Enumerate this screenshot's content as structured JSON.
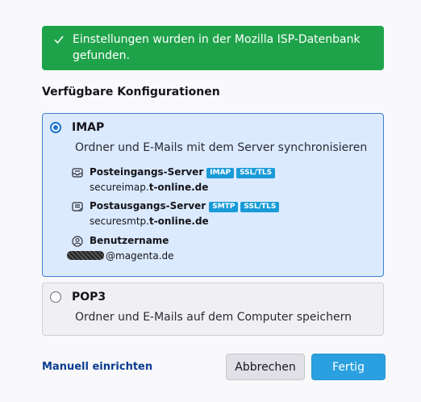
{
  "banner": {
    "text": "Einstellungen wurden in der Mozilla ISP-Datenbank gefunden.",
    "color": "#1fa34a"
  },
  "section_title": "Verfügbare Konfigurationen",
  "options": {
    "imap": {
      "title": "IMAP",
      "description": "Ordner und E-Mails mit dem Server synchronisieren",
      "selected": true,
      "incoming": {
        "label": "Posteingangs-Server",
        "badges": [
          "IMAP",
          "SSL/TLS"
        ],
        "host_prefix": "secureimap.",
        "host_domain": "t-online.de"
      },
      "outgoing": {
        "label": "Postausgangs-Server",
        "badges": [
          "SMTP",
          "SSL/TLS"
        ],
        "host_prefix": "securesmtp.",
        "host_domain": "t-online.de"
      },
      "username": {
        "label": "Benutzername",
        "value_suffix": "@magenta.de"
      }
    },
    "pop3": {
      "title": "POP3",
      "description": "Ordner und E-Mails auf dem Computer speichern",
      "selected": false
    }
  },
  "footer": {
    "manual_link": "Manuell einrichten",
    "cancel_label": "Abbrechen",
    "done_label": "Fertig"
  },
  "colors": {
    "accent": "#2aa0e0",
    "badge": "#1a9bd7",
    "selected_border": "#3b82d6",
    "selected_bg": "#dbeafe"
  }
}
